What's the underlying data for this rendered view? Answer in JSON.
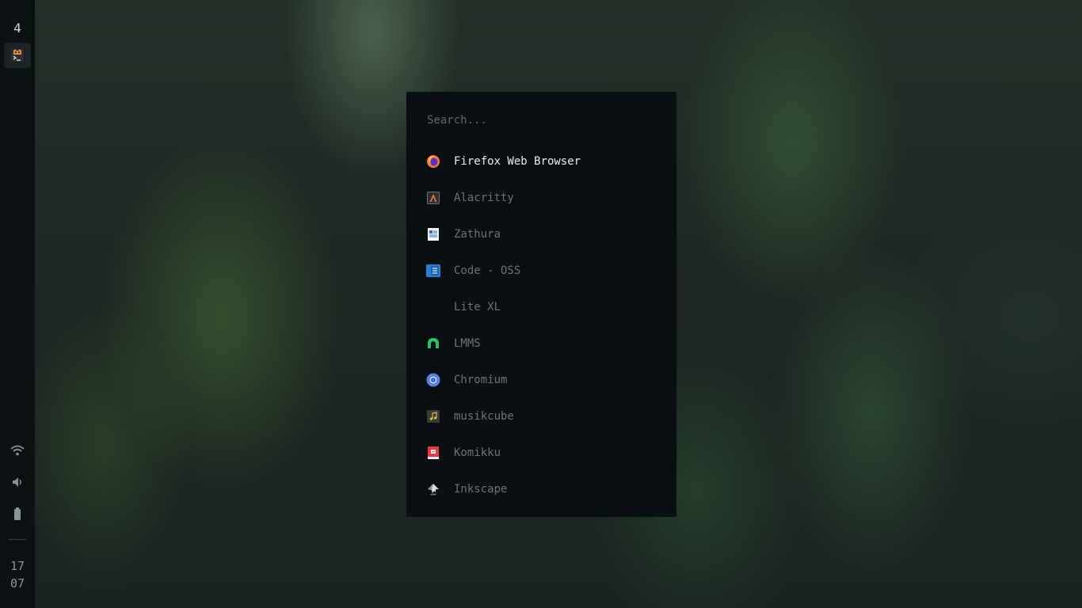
{
  "sidebar": {
    "workspace": "4",
    "active_task_icon": "terminal-icon",
    "status_icons": [
      "wifi-icon",
      "volume-icon",
      "battery-icon"
    ],
    "clock_hour": "17",
    "clock_minute": "07"
  },
  "launcher": {
    "search_placeholder": "Search...",
    "search_value": "",
    "selected_index": 0,
    "apps": [
      {
        "label": "Firefox Web Browser",
        "icon": "firefox-icon"
      },
      {
        "label": "Alacritty",
        "icon": "alacritty-icon"
      },
      {
        "label": "Zathura",
        "icon": "zathura-icon"
      },
      {
        "label": "Code - OSS",
        "icon": "code-oss-icon"
      },
      {
        "label": "Lite XL",
        "icon": ""
      },
      {
        "label": "LMMS",
        "icon": "lmms-icon"
      },
      {
        "label": "Chromium",
        "icon": "chromium-icon"
      },
      {
        "label": "musikcube",
        "icon": "musikcube-icon"
      },
      {
        "label": "Komikku",
        "icon": "komikku-icon"
      },
      {
        "label": "Inkscape",
        "icon": "inkscape-icon"
      }
    ]
  },
  "colors": {
    "sidebar_bg": "#0c1114",
    "launcher_bg": "#0a0f12",
    "text_selected": "#e8ecee",
    "text_dim": "#6a7378"
  }
}
